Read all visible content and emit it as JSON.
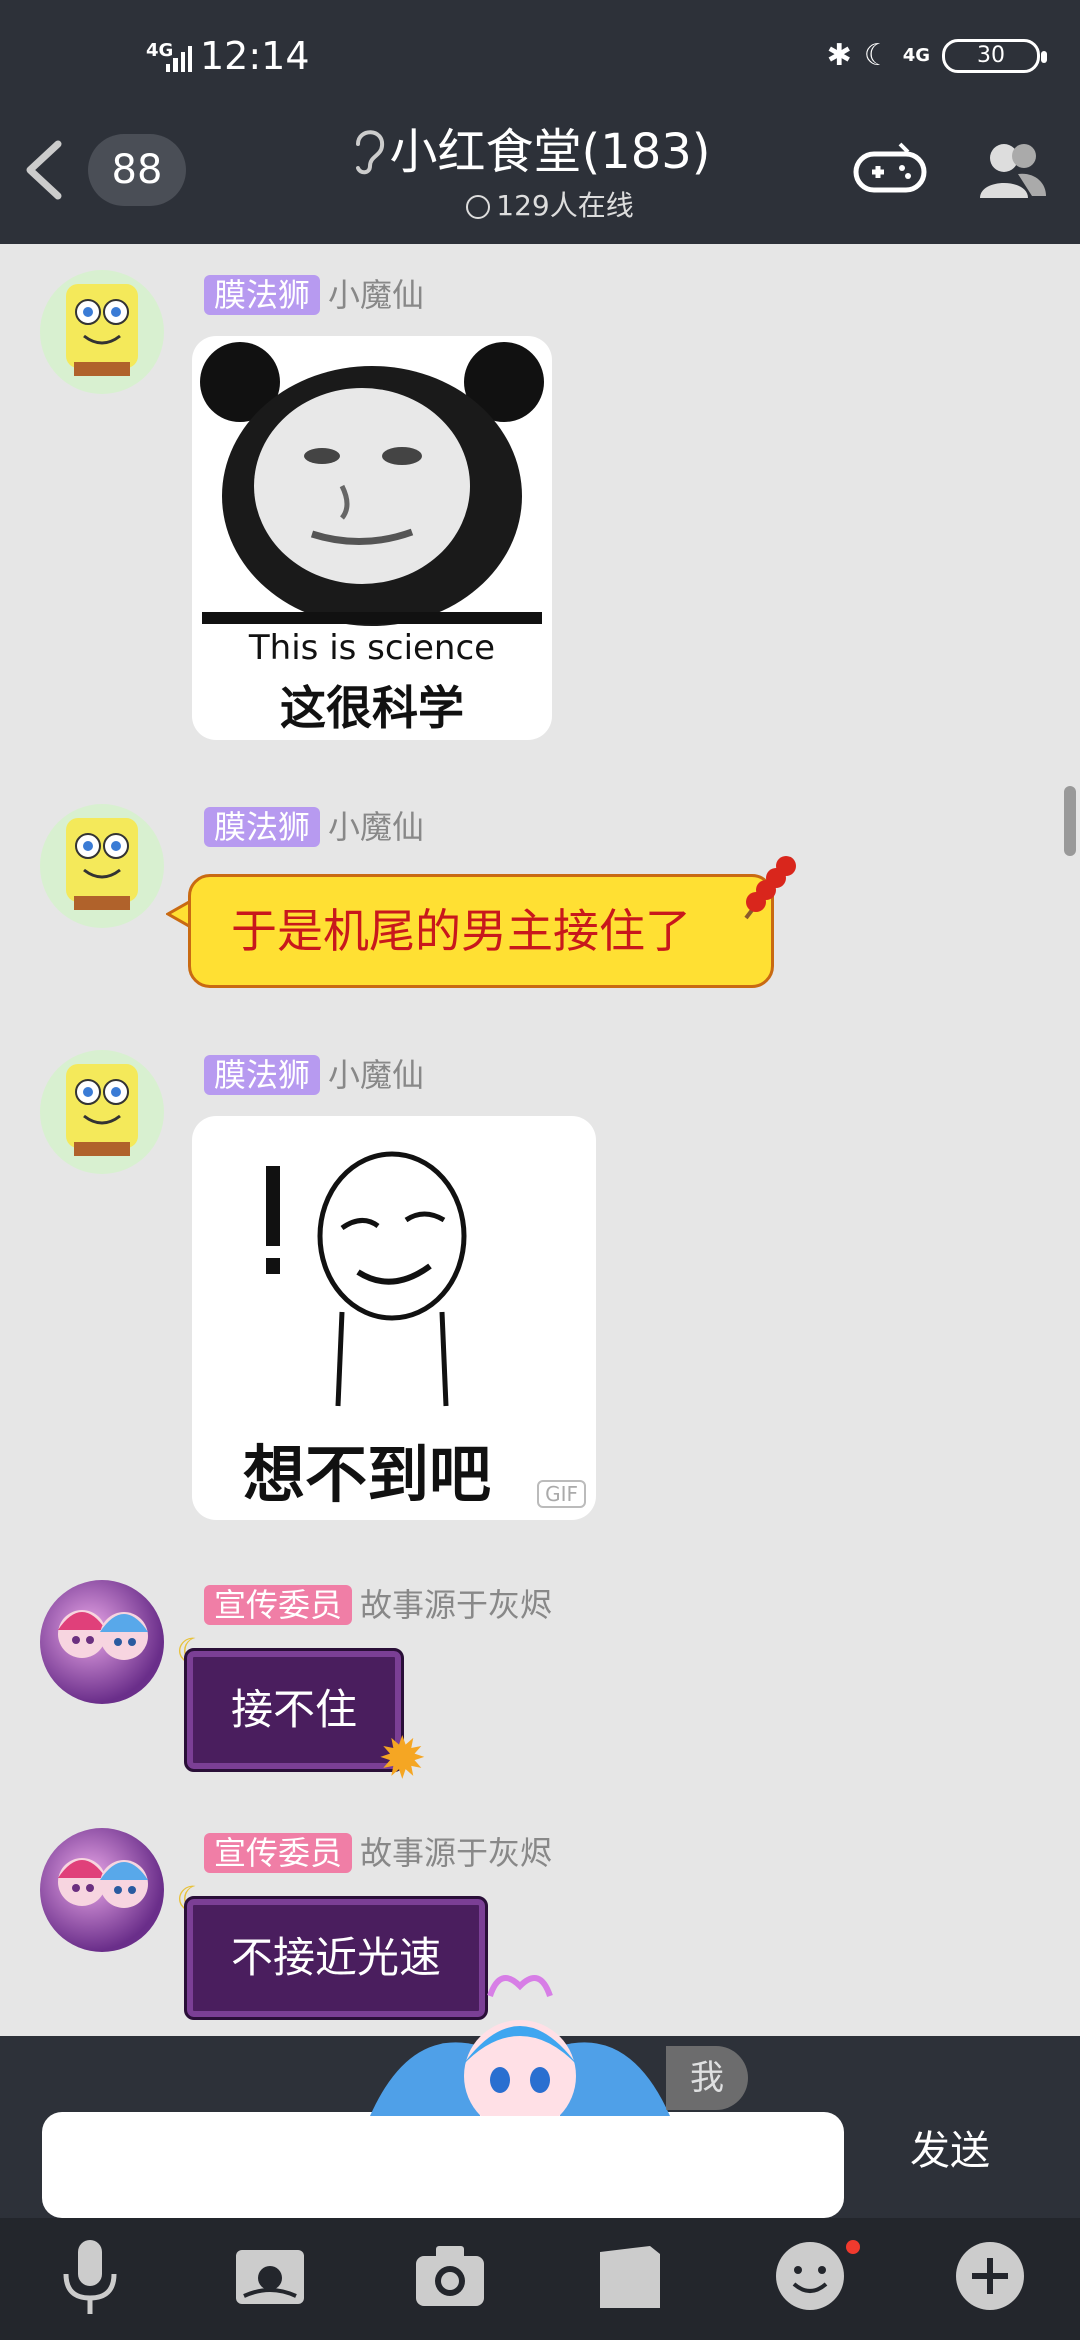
{
  "status_bar": {
    "network": "4G",
    "time": "12:14",
    "battery": "30",
    "network_right": "4G"
  },
  "header": {
    "unread_count": "88",
    "title": "小红食堂(183)",
    "online_count": "129人在线"
  },
  "messages": [
    {
      "tag": "膜法狮",
      "tag_color": "#b79af0",
      "name": "小魔仙",
      "type": "image",
      "caption_en": "This is science",
      "caption_cn": "这很科学"
    },
    {
      "tag": "膜法狮",
      "tag_color": "#b79af0",
      "name": "小魔仙",
      "type": "text",
      "text": "于是机尾的男主接住了"
    },
    {
      "tag": "膜法狮",
      "tag_color": "#b79af0",
      "name": "小魔仙",
      "type": "image",
      "caption_cn": "想不到吧",
      "gif_badge": "GIF"
    },
    {
      "tag": "宣传委员",
      "tag_color": "#f07ea6",
      "name": "故事源于灰烬",
      "type": "text",
      "text": "接不住"
    },
    {
      "tag": "宣传委员",
      "tag_color": "#f07ea6",
      "name": "故事源于灰烬",
      "type": "text",
      "text": "不接近光速"
    }
  ],
  "composer": {
    "me_label": "我",
    "send_label": "发送"
  },
  "toolbar": {
    "icons": [
      "microphone-icon",
      "photo-icon",
      "camera-icon",
      "folder-icon",
      "emoji-icon",
      "plus-icon"
    ]
  }
}
